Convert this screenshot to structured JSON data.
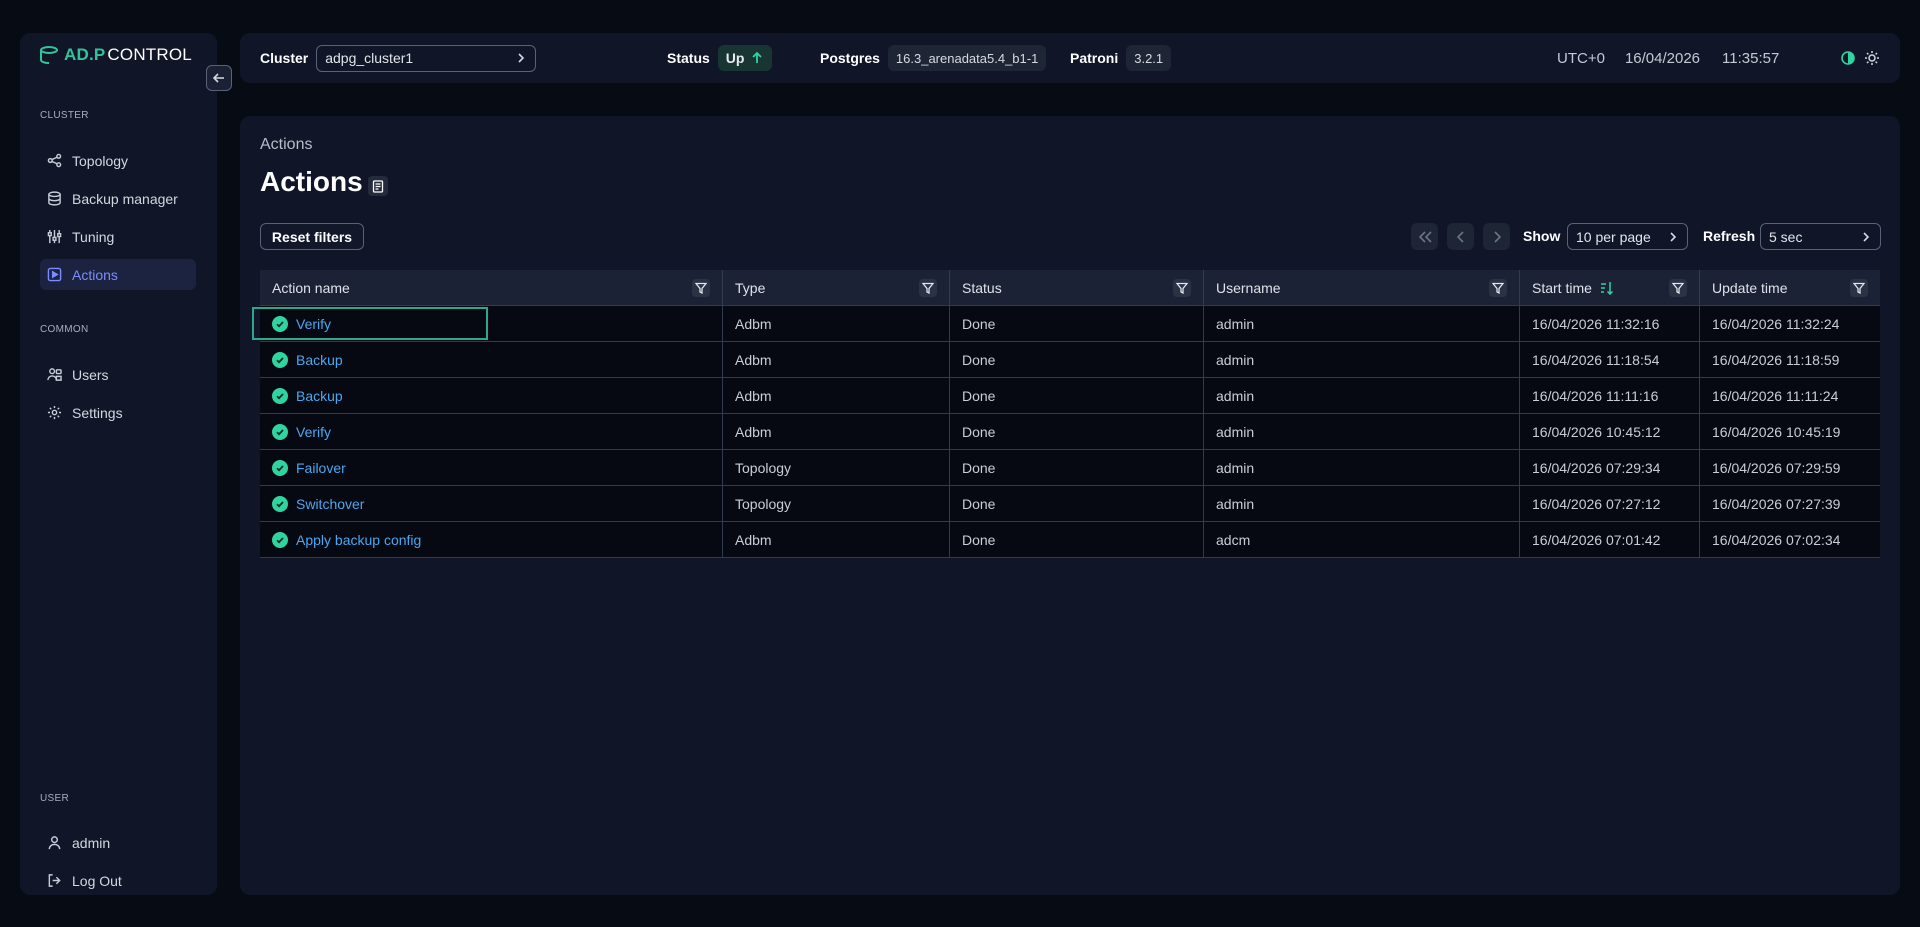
{
  "brand": {
    "logo_a": "AD.P",
    "logo_b": "CONTROL"
  },
  "sidebar": {
    "cluster_section": "CLUSTER",
    "cluster_items": [
      "Topology",
      "Backup manager",
      "Tuning",
      "Actions"
    ],
    "common_section": "COMMON",
    "common_items": [
      "Users",
      "Settings"
    ],
    "user_section": "USER",
    "user_items": [
      "admin",
      "Log Out"
    ]
  },
  "topbar": {
    "cluster_label": "Cluster",
    "cluster_value": "adpg_cluster1",
    "status_label": "Status",
    "status_value": "Up",
    "postgres_label": "Postgres",
    "postgres_value": "16.3_arenadata5.4_b1-1",
    "patroni_label": "Patroni",
    "patroni_value": "3.2.1",
    "timezone": "UTC+0",
    "date": "16/04/2026",
    "time": "11:35:57"
  },
  "page": {
    "breadcrumb": "Actions",
    "title": "Actions",
    "reset_filters": "Reset filters",
    "show_label": "Show",
    "show_value": "10 per page",
    "refresh_label": "Refresh",
    "refresh_value": "5 sec"
  },
  "table": {
    "columns": [
      "Action name",
      "Type",
      "Status",
      "Username",
      "Start time",
      "Update time"
    ],
    "rows": [
      {
        "name": "Verify",
        "type": "Adbm",
        "status": "Done",
        "user": "admin",
        "start": "16/04/2026 11:32:16",
        "update": "16/04/2026 11:32:24"
      },
      {
        "name": "Backup",
        "type": "Adbm",
        "status": "Done",
        "user": "admin",
        "start": "16/04/2026 11:18:54",
        "update": "16/04/2026 11:18:59"
      },
      {
        "name": "Backup",
        "type": "Adbm",
        "status": "Done",
        "user": "admin",
        "start": "16/04/2026 11:11:16",
        "update": "16/04/2026 11:11:24"
      },
      {
        "name": "Verify",
        "type": "Adbm",
        "status": "Done",
        "user": "admin",
        "start": "16/04/2026 10:45:12",
        "update": "16/04/2026 10:45:19"
      },
      {
        "name": "Failover",
        "type": "Topology",
        "status": "Done",
        "user": "admin",
        "start": "16/04/2026 07:29:34",
        "update": "16/04/2026 07:29:59"
      },
      {
        "name": "Switchover",
        "type": "Topology",
        "status": "Done",
        "user": "admin",
        "start": "16/04/2026 07:27:12",
        "update": "16/04/2026 07:27:39"
      },
      {
        "name": "Apply backup config",
        "type": "Adbm",
        "status": "Done",
        "user": "adcm",
        "start": "16/04/2026 07:01:42",
        "update": "16/04/2026 07:02:34"
      }
    ]
  },
  "colors": {
    "accent": "#7b8cff",
    "success": "#2fd4a0",
    "link": "#4aa7ef",
    "brand": "#2fc49a"
  },
  "icons": [
    "logo-icon",
    "arrow-left-icon",
    "topology-icon",
    "database-icon",
    "sliders-icon",
    "play-icon",
    "users-icon",
    "gear-icon",
    "user-icon",
    "logout-icon",
    "arrow-up-icon",
    "chevron-right-icon",
    "contrast-icon",
    "sun-icon",
    "document-icon",
    "double-chevron-left-icon",
    "chevron-left-icon",
    "filter-icon",
    "sort-icon",
    "check-circle-icon"
  ]
}
